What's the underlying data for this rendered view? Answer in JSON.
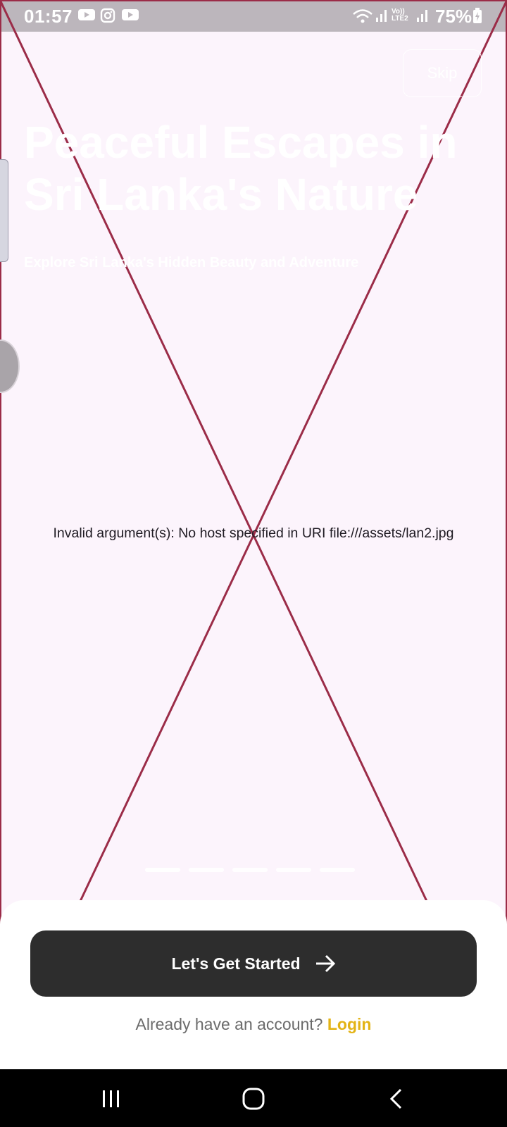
{
  "status_bar": {
    "time": "01:57",
    "battery": "75%",
    "icons": [
      "youtube-icon",
      "instagram-icon",
      "youtube-icon",
      "wifi-icon",
      "signal-icon",
      "volte-icon",
      "signal-icon",
      "battery-charging-icon"
    ]
  },
  "screen": {
    "skip_label": "Skip",
    "title_line1": "Peaceful Escapes in",
    "title_line2": "Sri Lanka's Nature",
    "subtitle": "Explore Sri Lanka's Hidden Beauty and Adventure",
    "error_message": "Invalid argument(s): No host specified in URI file:///assets/lan2.jpg",
    "page_count": 5,
    "active_page": 1
  },
  "bottom_sheet": {
    "cta_label": "Let's Get Started",
    "account_prompt": "Already have an account?",
    "login_label": "Login"
  },
  "colors": {
    "error_cross": "#9b2c48",
    "cta_bg": "#2d2d2d",
    "login_accent": "#e3b315"
  },
  "nav_bar": {
    "buttons": [
      "recents-icon",
      "home-icon",
      "back-icon"
    ]
  }
}
